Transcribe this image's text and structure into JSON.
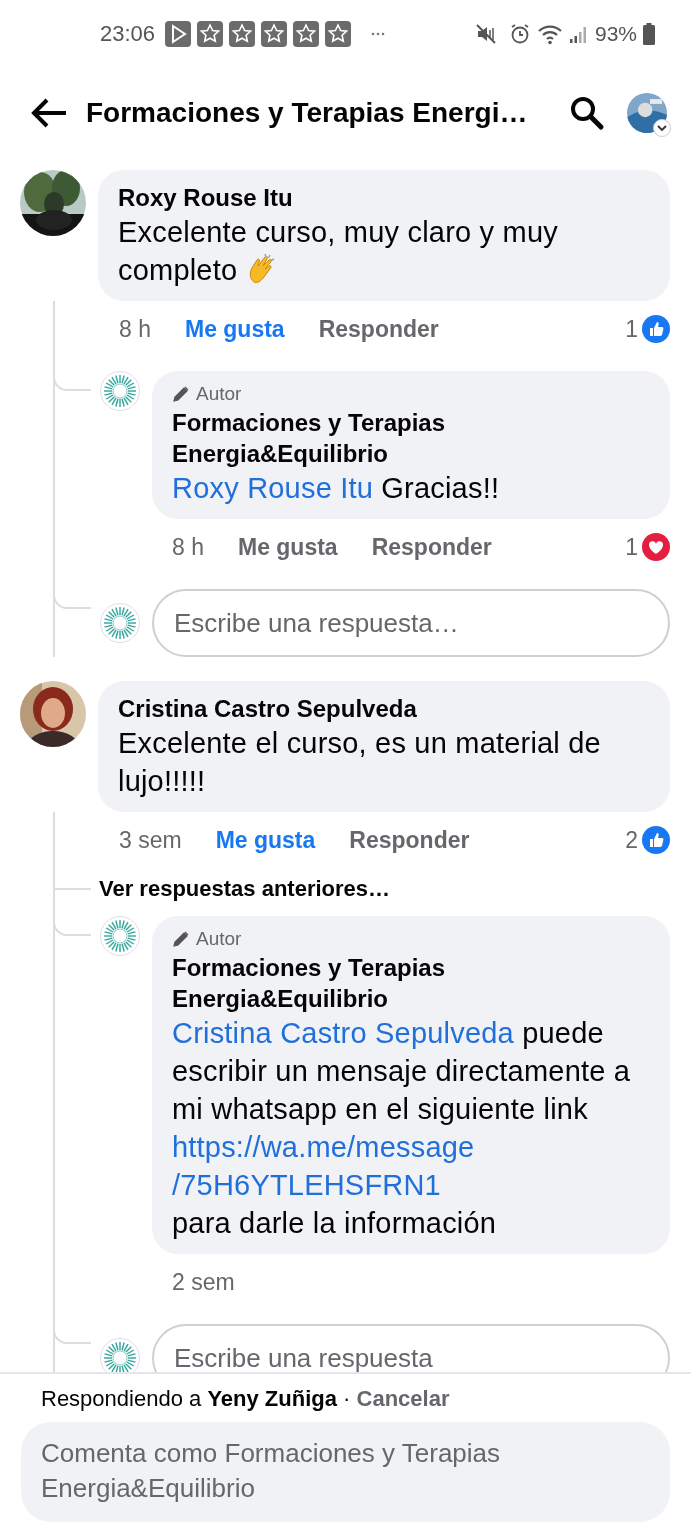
{
  "status_bar": {
    "time": "23:06",
    "battery": "93%"
  },
  "header": {
    "title": "Formaciones y Terapias Energi…"
  },
  "comments": [
    {
      "author": "Roxy Rouse Itu",
      "text": "Excelente curso, muy claro y muy completo",
      "clap_emoji": true,
      "time": "8 h",
      "like_label": "Me gusta",
      "liked": true,
      "reply_label": "Responder",
      "reaction": {
        "kind": "like",
        "count": "1"
      },
      "replies": [
        {
          "kind": "reply",
          "badge": "Autor",
          "author": "Formaciones y Terapias Energia&Equilibrio",
          "segments": [
            {
              "kind": "mention",
              "text": "Roxy Rouse Itu"
            },
            {
              "kind": "plain",
              "text": " Gracias!!"
            }
          ],
          "time": "8 h",
          "like_label": "Me gusta",
          "liked": false,
          "reply_label": "Responder",
          "reaction": {
            "kind": "love",
            "count": "1"
          }
        },
        {
          "kind": "field",
          "placeholder": "Escribe una respuesta…"
        }
      ]
    },
    {
      "author": "Cristina Castro Sepulveda",
      "text": "Excelente el curso, es un material de lujo!!!!!",
      "time": "3 sem",
      "like_label": "Me gusta",
      "liked": true,
      "reply_label": "Responder",
      "reaction": {
        "kind": "like",
        "count": "2"
      },
      "more_replies": "Ver respuestas anteriores…",
      "replies": [
        {
          "kind": "reply",
          "badge": "Autor",
          "author": "Formaciones y Terapias Energia&Equilibrio",
          "segments": [
            {
              "kind": "mention",
              "text": "Cristina Castro Sepulveda"
            },
            {
              "kind": "plain",
              "text": " puede escribir un mensaje directamente a mi whatsapp en el siguiente link "
            },
            {
              "kind": "link",
              "text": "https://wa.me/message/75H6YTLEHSFRN1"
            },
            {
              "kind": "plain",
              "text": " para darle la información"
            }
          ],
          "time": "2 sem"
        },
        {
          "kind": "field",
          "placeholder": "Escribe una respuesta"
        }
      ]
    }
  ],
  "composer": {
    "prefix": "Respondiendo a",
    "replying_to": "Yeny Zuñiga",
    "separator": "·",
    "cancel": "Cancelar",
    "placeholder": "Comenta como Formaciones y Terapias Energia&Equilibrio"
  }
}
